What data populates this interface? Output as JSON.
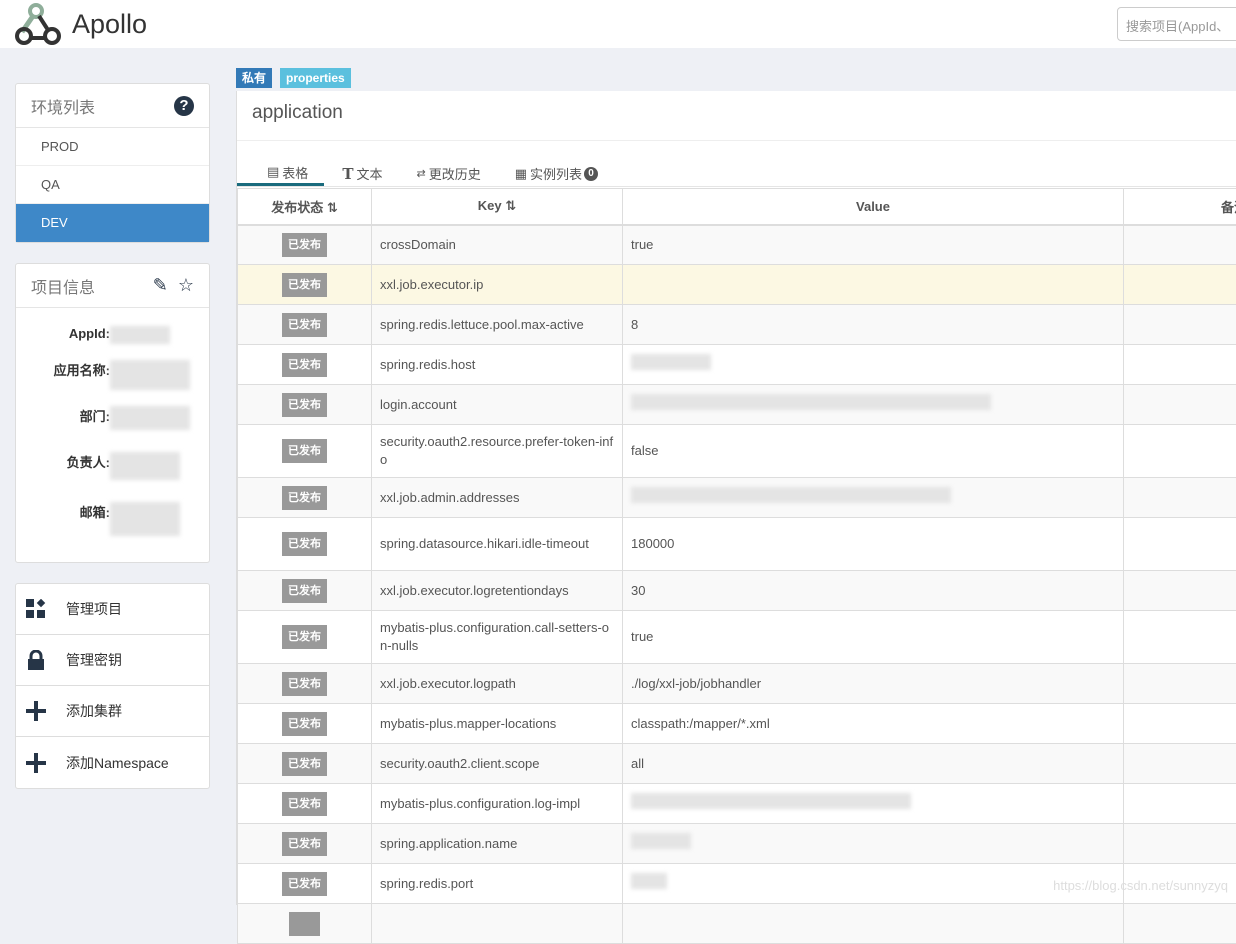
{
  "header": {
    "logo_text": "Apollo",
    "search_placeholder": "搜索项目(AppId、"
  },
  "env_panel": {
    "title": "环境列表",
    "envs": [
      "PROD",
      "QA",
      "DEV"
    ],
    "active": "DEV"
  },
  "project_panel": {
    "title": "项目信息",
    "labels": [
      "AppId:",
      "应用名称:",
      "部门:",
      "负责人:",
      "邮箱:"
    ]
  },
  "actions": [
    "管理项目",
    "管理密钥",
    "添加集群",
    "添加Namespace"
  ],
  "namespace": {
    "badge_private": "私有",
    "badge_format": "properties",
    "name": "application"
  },
  "tabs": [
    "表格",
    "文本",
    "更改历史",
    "实例列表"
  ],
  "instance_count": "0",
  "columns": [
    "发布状态",
    "Key",
    "Value",
    "备注"
  ],
  "rows": [
    {
      "status": "已发布",
      "key": "crossDomain",
      "value": "true"
    },
    {
      "status": "已发布",
      "key": "xxl.job.executor.ip",
      "value": ""
    },
    {
      "status": "已发布",
      "key": "spring.redis.lettuce.pool.max-active",
      "value": "8"
    },
    {
      "status": "已发布",
      "key": "spring.redis.host",
      "value": null
    },
    {
      "status": "已发布",
      "key": "login.account",
      "value": null
    },
    {
      "status": "已发布",
      "key": "security.oauth2.resource.prefer-token-info",
      "value": "false"
    },
    {
      "status": "已发布",
      "key": "xxl.job.admin.addresses",
      "value": null
    },
    {
      "status": "已发布",
      "key": "spring.datasource.hikari.idle-timeout",
      "value": "180000"
    },
    {
      "status": "已发布",
      "key": "xxl.job.executor.logretentiondays",
      "value": "30"
    },
    {
      "status": "已发布",
      "key": "mybatis-plus.configuration.call-setters-on-nulls",
      "value": "true"
    },
    {
      "status": "已发布",
      "key": "xxl.job.executor.logpath",
      "value": "./log/xxl-job/jobhandler"
    },
    {
      "status": "已发布",
      "key": "mybatis-plus.mapper-locations",
      "value": "classpath:/mapper/*.xml"
    },
    {
      "status": "已发布",
      "key": "security.oauth2.client.scope",
      "value": "all"
    },
    {
      "status": "已发布",
      "key": "mybatis-plus.configuration.log-impl",
      "value": null
    },
    {
      "status": "已发布",
      "key": "spring.application.name",
      "value": null
    },
    {
      "status": "已发布",
      "key": "spring.redis.port",
      "value": null
    }
  ],
  "watermark": "https://blog.csdn.net/sunnyzyq"
}
